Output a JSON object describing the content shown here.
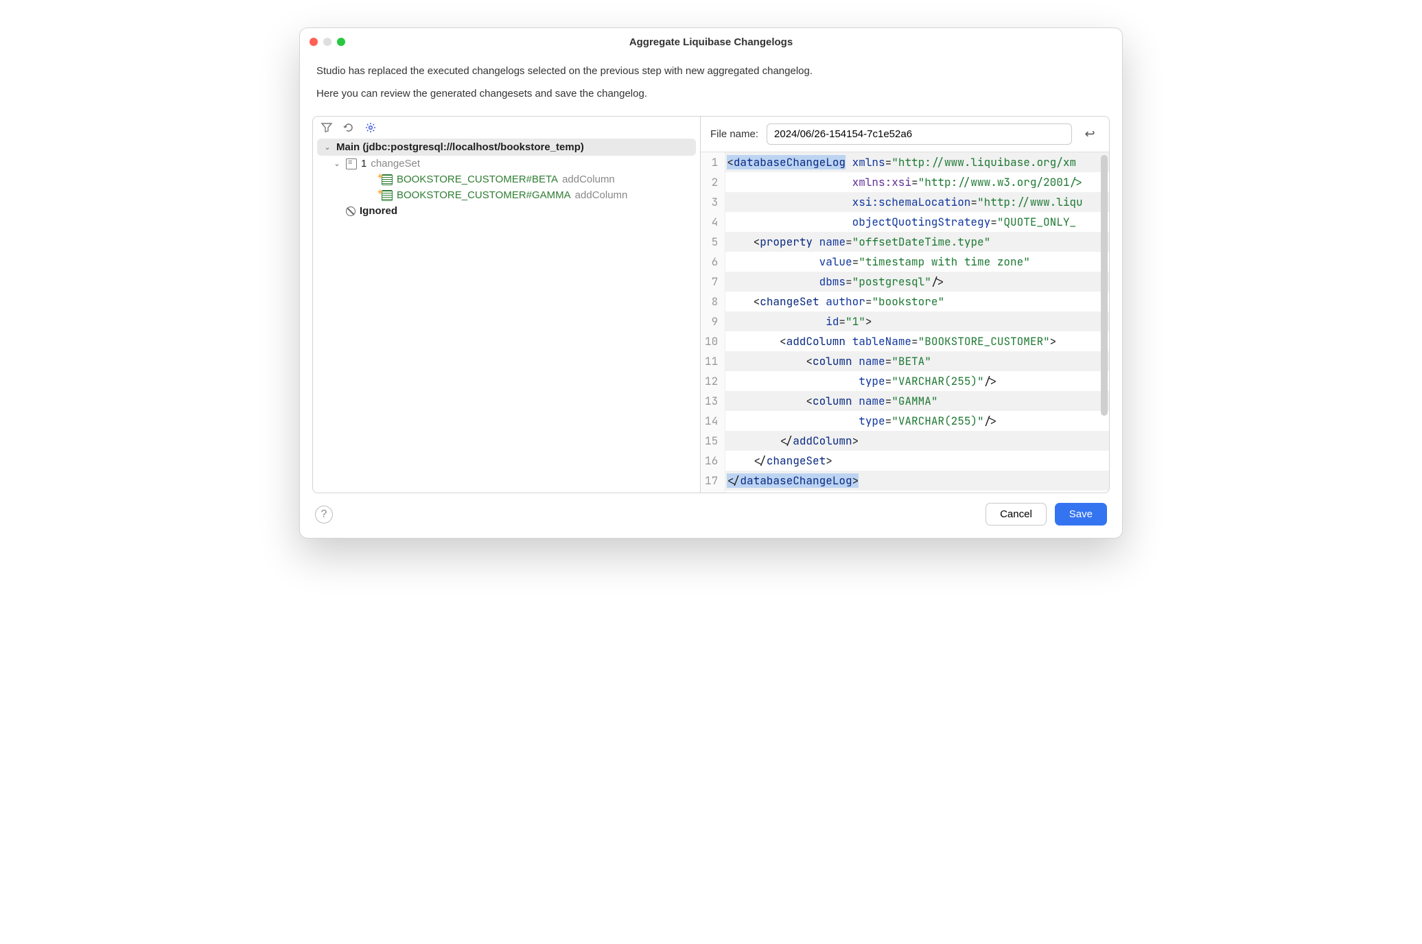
{
  "title": "Aggregate Liquibase Changelogs",
  "description1": "Studio has replaced the executed changelogs selected on the previous step with new aggregated changelog.",
  "description2": "Here you can review the generated changesets and save the changelog.",
  "tree": {
    "main_label": "Main (jdbc:postgresql://localhost/bookstore_temp)",
    "changeset_label_prefix": "1",
    "changeset_label_suffix": " changeSet",
    "addcol1_green": "BOOKSTORE_CUSTOMER#BETA",
    "addcol1_gray": " addColumn",
    "addcol2_green": "BOOKSTORE_CUSTOMER#GAMMA",
    "addcol2_gray": " addColumn",
    "ignored_label": "Ignored"
  },
  "file": {
    "label": "File name:",
    "value": "2024/06/26-154154-7c1e52a6"
  },
  "code_lines": [
    {
      "n": 1,
      "html": "<span class='hl-xmltag'>&lt;<span class='tag'>databaseChangeLog</span></span> <span class='attr'>xmlns</span>=<span class='str'>\"http://www.liquibase.org/xm</span>"
    },
    {
      "n": 2,
      "html": "                   <span class='ns'>xmlns:xsi</span>=<span class='str'>\"http://www.w3.org/2001/&gt;</span>"
    },
    {
      "n": 3,
      "html": "                   <span class='attr'>xsi:schemaLocation</span>=<span class='str'>\"http://www.liqu</span>"
    },
    {
      "n": 4,
      "html": "                   <span class='attr'>objectQuotingStrategy</span>=<span class='str'>\"QUOTE_ONLY_</span>"
    },
    {
      "n": 5,
      "html": "    &lt;<span class='tag'>property</span> <span class='attr'>name</span>=<span class='str'>\"offsetDateTime.type\"</span>"
    },
    {
      "n": 6,
      "html": "              <span class='attr'>value</span>=<span class='str'>\"timestamp with time zone\"</span>"
    },
    {
      "n": 7,
      "html": "              <span class='attr'>dbms</span>=<span class='str'>\"postgresql\"</span>/&gt;"
    },
    {
      "n": 8,
      "html": "    &lt;<span class='tag'>changeSet</span> <span class='attr'>author</span>=<span class='str'>\"bookstore\"</span>"
    },
    {
      "n": 9,
      "html": "               <span class='attr'>id</span>=<span class='str'>\"1\"</span>&gt;"
    },
    {
      "n": 10,
      "html": "        &lt;<span class='tag'>addColumn</span> <span class='attr'>tableName</span>=<span class='str'>\"BOOKSTORE_CUSTOMER\"</span>&gt;"
    },
    {
      "n": 11,
      "html": "            &lt;<span class='tag'>column</span> <span class='attr'>name</span>=<span class='str'>\"BETA\"</span>"
    },
    {
      "n": 12,
      "html": "                    <span class='attr'>type</span>=<span class='str'>\"VARCHAR(255)\"</span>/&gt;"
    },
    {
      "n": 13,
      "html": "            &lt;<span class='tag'>column</span> <span class='attr'>name</span>=<span class='str'>\"GAMMA\"</span>"
    },
    {
      "n": 14,
      "html": "                    <span class='attr'>type</span>=<span class='str'>\"VARCHAR(255)\"</span>/&gt;"
    },
    {
      "n": 15,
      "html": "        &lt;/<span class='tag'>addColumn</span>&gt;"
    },
    {
      "n": 16,
      "html": "    &lt;/<span class='tag'>changeSet</span>&gt;"
    },
    {
      "n": 17,
      "html": "<span class='hl-xmltag'>&lt;/<span class='tag'>databaseChangeLog</span>&gt;</span>"
    }
  ],
  "buttons": {
    "cancel": "Cancel",
    "save": "Save"
  }
}
